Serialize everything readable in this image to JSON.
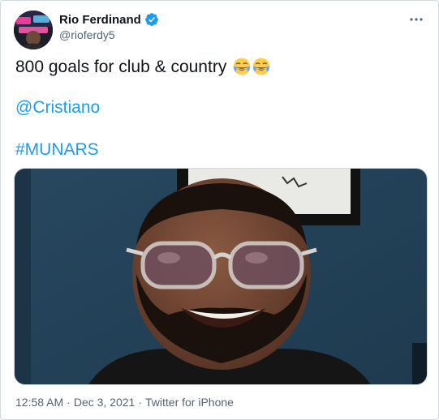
{
  "tweet": {
    "author": {
      "display_name": "Rio Ferdinand",
      "handle": "@rioferdy5",
      "verified": true,
      "avatar_icon": "profile-photo"
    },
    "more_icon": "more-options-icon",
    "text": "800 goals for club & country",
    "emojis": [
      "face-with-tears-of-joy",
      "face-with-tears-of-joy"
    ],
    "mention": "@Cristiano",
    "hashtag": "#MUNARS",
    "media": {
      "type": "video-thumbnail",
      "description_icon": "smiling-man-sunglasses"
    },
    "time": "12:58 AM",
    "date": "Dec 3, 2021",
    "source": "Twitter for iPhone",
    "separator": "·"
  },
  "colors": {
    "link": "#1d9bf0",
    "secondary_text": "#536471",
    "primary_text": "#0f1419",
    "border": "#cfd9de"
  }
}
